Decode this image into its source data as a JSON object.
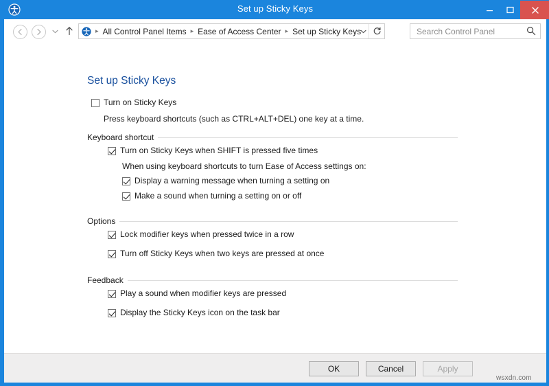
{
  "window": {
    "title": "Set up Sticky Keys",
    "app_icon": "ease-of-access-icon",
    "minimize_label": "–",
    "maximize_label": "□",
    "close_label": "✕",
    "accent_color": "#1b85dd",
    "close_color": "#d9534f"
  },
  "navbar": {
    "back_label": "←",
    "forward_label": "→",
    "recent_label": "▾",
    "up_label": "↑",
    "address_icon": "control-panel-icon",
    "breadcrumbs": [
      "All Control Panel Items",
      "Ease of Access Center",
      "Set up Sticky Keys"
    ],
    "separator": "▸",
    "dropdown_label": "˅",
    "refresh_label": "⟳"
  },
  "search": {
    "placeholder": "Search Control Panel",
    "value": "",
    "icon": "⌕"
  },
  "page": {
    "title": "Set up Sticky Keys",
    "master": {
      "label": "Turn on Sticky Keys",
      "checked": false
    },
    "master_description": "Press keyboard shortcuts (such as CTRL+ALT+DEL) one key at a time.",
    "sections": [
      {
        "name": "keyboard-shortcut",
        "title": "Keyboard shortcut",
        "items": [
          {
            "label": "Turn on Sticky Keys when SHIFT is pressed five times",
            "checked": true
          },
          {
            "label": "Display a warning message when turning a setting on",
            "checked": true
          },
          {
            "label": "Make a sound when turning a setting on or off",
            "checked": true
          }
        ],
        "note": "When using keyboard shortcuts to turn Ease of Access settings on:"
      },
      {
        "name": "options",
        "title": "Options",
        "items": [
          {
            "label": "Lock modifier keys when pressed twice in a row",
            "checked": true
          },
          {
            "label": "Turn off Sticky Keys when two keys are pressed at once",
            "checked": true
          }
        ]
      },
      {
        "name": "feedback",
        "title": "Feedback",
        "items": [
          {
            "label": "Play a sound when modifier keys are pressed",
            "checked": true
          },
          {
            "label": "Display the Sticky Keys icon on the task bar",
            "checked": true
          }
        ]
      }
    ]
  },
  "footer": {
    "ok": "OK",
    "cancel": "Cancel",
    "apply": "Apply",
    "apply_enabled": false
  },
  "watermark": "wsxdn.com"
}
